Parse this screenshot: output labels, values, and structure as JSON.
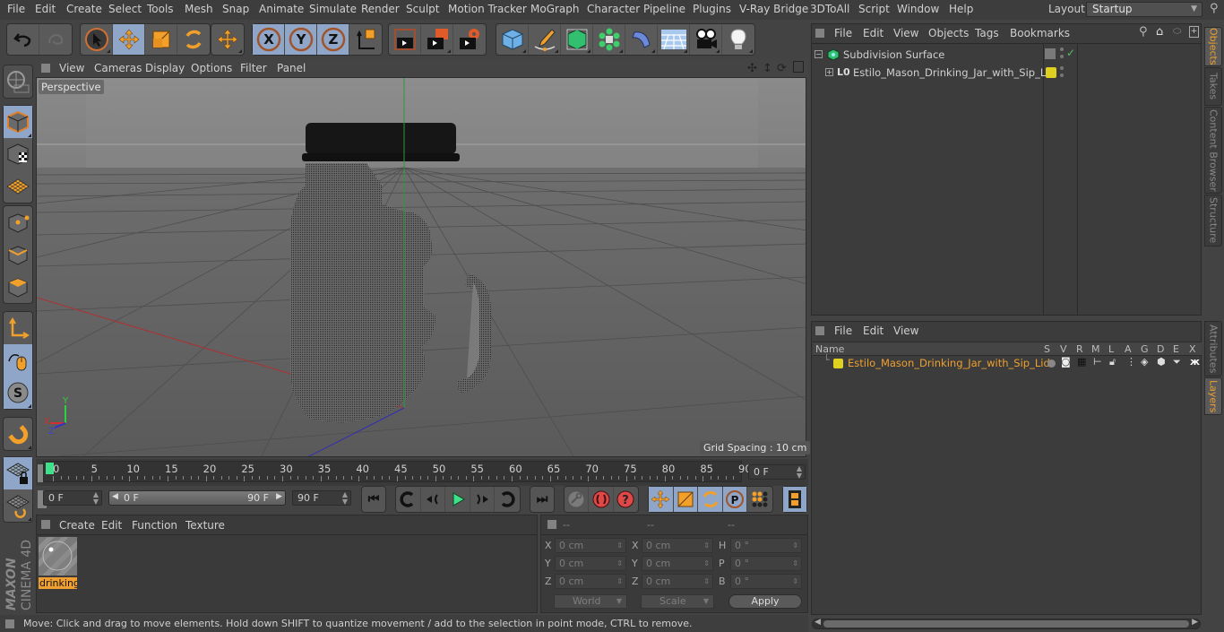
{
  "menubar": {
    "items": [
      "File",
      "Edit",
      "Create",
      "Select",
      "Tools",
      "Mesh",
      "Snap",
      "Animate",
      "Simulate",
      "Render",
      "Sculpt",
      "Motion Tracker",
      "MoGraph",
      "Character",
      "Pipeline",
      "Plugins",
      "V-Ray Bridge",
      "3DToAll",
      "Script",
      "Window",
      "Help"
    ],
    "layout_label": "Layout:",
    "layout_value": "Startup"
  },
  "toolbar": {
    "groups": [
      [
        "undo-icon",
        "redo-icon"
      ],
      [
        "live-selection-icon",
        "move-icon",
        "scale-icon",
        "rotate-icon"
      ],
      [
        "last-tool-move-icon"
      ],
      [
        "x-axis-lock-icon",
        "y-axis-lock-icon",
        "z-axis-lock-icon",
        "coordinate-system-icon"
      ],
      [
        "render-view-icon",
        "render-to-picture-viewer-icon",
        "render-settings-icon"
      ],
      [
        "cube-primitive-icon",
        "pen-spline-icon",
        "subdivision-generator-icon",
        "mograph-cloner-icon",
        "deformer-bend-icon",
        "floor-environment-icon",
        "camera-icon",
        "light-icon"
      ]
    ]
  },
  "viewport": {
    "menu": [
      "View",
      "Cameras",
      "Display",
      "Options",
      "Filter",
      "Panel"
    ],
    "camera_label": "Perspective",
    "grid_spacing": "Grid Spacing : 10 cm",
    "nav_icons": [
      "pan-icon",
      "dolly-icon",
      "orbit-icon",
      "maximize-view-icon"
    ],
    "axis": {
      "x": "X",
      "y": "Y",
      "z": "Z"
    }
  },
  "left_tools": [
    "make-editable-icon",
    "model-mode-icon",
    "texture-mode-icon",
    "workplane-mode-icon",
    "points-mode-icon",
    "edges-mode-icon",
    "polygons-mode-icon",
    "axis-mode-icon",
    "tweak-mode-icon",
    "solo-mode-icon",
    "snap-magnet-icon",
    "lock-workplane-icon",
    "workplane-align-icon"
  ],
  "brand": {
    "line1": "MAXON",
    "line2": "CINEMA 4D"
  },
  "timeline": {
    "ticks": [
      "0",
      "5",
      "10",
      "15",
      "20",
      "25",
      "30",
      "35",
      "40",
      "45",
      "50",
      "55",
      "60",
      "65",
      "70",
      "75",
      "80",
      "85",
      "90"
    ],
    "current_frame": "0 F",
    "start_field": "0 F",
    "range_start": "0 F",
    "range_end": "90 F",
    "end_field": "90 F",
    "playhead_frame": 0
  },
  "transport": {
    "buttons": [
      "go-to-start-icon",
      "previous-key-icon",
      "previous-frame-icon",
      "play-icon",
      "next-frame-icon",
      "next-key-icon",
      "go-to-end-icon",
      "record-keys-icon",
      "autokey-icon",
      "keyframe-selection-icon",
      "move-key-icon",
      "scale-key-icon",
      "rotate-key-icon",
      "param-key-icon",
      "pla-key-icon",
      "timeline-window-icon"
    ]
  },
  "materials": {
    "menu": [
      "Create",
      "Edit",
      "Function",
      "Texture"
    ],
    "items": [
      {
        "name": "drinking"
      }
    ]
  },
  "coordinates": {
    "headers": [
      "--",
      "--",
      "--"
    ],
    "rows": [
      {
        "l1": "X",
        "v1": "0 cm",
        "l2": "X",
        "v2": "0 cm",
        "l3": "H",
        "v3": "0 °"
      },
      {
        "l1": "Y",
        "v1": "0 cm",
        "l2": "Y",
        "v2": "0 cm",
        "l3": "P",
        "v3": "0 °"
      },
      {
        "l1": "Z",
        "v1": "0 cm",
        "l2": "Z",
        "v2": "0 cm",
        "l3": "B",
        "v3": "0 °"
      }
    ],
    "space": "World",
    "mode": "Scale",
    "apply_label": "Apply"
  },
  "status": {
    "text": "Move: Click and drag to move elements. Hold down SHIFT to quantize movement / add to the selection in point mode, CTRL to remove."
  },
  "objects": {
    "menu": [
      "File",
      "Edit",
      "View",
      "Objects",
      "Tags",
      "Bookmarks"
    ],
    "tree": [
      {
        "name": "Subdivision Surface",
        "depth": 0,
        "expanded": true,
        "enabled": true
      },
      {
        "name": "Estilo_Mason_Drinking_Jar_with_Sip_Lid",
        "depth": 1,
        "expanded": false,
        "layer_color": "#e0d020"
      }
    ]
  },
  "layers": {
    "menu": [
      "File",
      "Edit",
      "View"
    ],
    "columns": [
      "Name",
      "S",
      "V",
      "R",
      "M",
      "L",
      "A",
      "G",
      "D",
      "E",
      "X"
    ],
    "rows": [
      {
        "name": "Estilo_Mason_Drinking_Jar_with_Sip_Lid",
        "color": "#e0d020"
      }
    ]
  },
  "side_tabs_top": [
    {
      "label": "Objects",
      "active": true
    },
    {
      "label": "Takes",
      "active": false
    },
    {
      "label": "Content Browser",
      "active": false
    },
    {
      "label": "Structure",
      "active": false
    }
  ],
  "side_tabs_bottom": [
    {
      "label": "Attributes",
      "active": false
    },
    {
      "label": "Layers",
      "active": true
    }
  ],
  "colors": {
    "accent": "#f0a030",
    "selected_bg": "#8fa6c8",
    "play": "#3ee08a",
    "layer_yellow": "#e0d020"
  }
}
